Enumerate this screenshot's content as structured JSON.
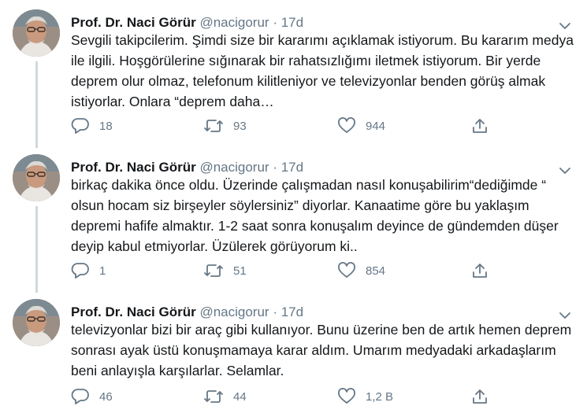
{
  "tweets": [
    {
      "name": "Prof. Dr. Naci Görür",
      "handle": "@nacigorur",
      "separator": "·",
      "time": "17d",
      "text": "Sevgili takipcilerim. Şimdi size bir kararımı açıklamak istiyorum. Bu kararım medya ile ilgili. Hoşgörülerine sığınarak bir rahatsızlığımı iletmek istiyorum. Bir yerde deprem olur olmaz, telefonum kilitleniyor ve televizyonlar benden görüş almak istiyorlar. Onlara “deprem daha…",
      "replies": "18",
      "retweets": "93",
      "likes": "944"
    },
    {
      "name": "Prof. Dr. Naci Görür",
      "handle": "@nacigorur",
      "separator": "·",
      "time": "17d",
      "text": "birkaç dakika önce oldu. Üzerinde çalışmadan nasıl konuşabilirim“dediğimde “ olsun hocam siz birşeyler söylersiniz” diyorlar. Kanaatime göre bu yaklaşım depremi hafife almaktır. 1-2 saat sonra konuşalım deyince de gündemden düşer deyip kabul etmiyorlar. Üzülerek görüyorum ki..",
      "replies": "1",
      "retweets": "51",
      "likes": "854"
    },
    {
      "name": "Prof. Dr. Naci Görür",
      "handle": "@nacigorur",
      "separator": "·",
      "time": "17d",
      "text": "televizyonlar bizi bir araç gibi kullanıyor. Bunu üzerine ben de artık hemen deprem sonrası ayak üstü konuşmamaya karar aldım. Umarım medyadaki arkadaşlarım beni anlayışla karşılarlar. Selamlar.",
      "replies": "46",
      "retweets": "44",
      "likes": "1,2 B"
    }
  ],
  "icons": {
    "reply": "reply-icon",
    "retweet": "retweet-icon",
    "like": "heart-icon",
    "share": "share-icon",
    "more": "chevron-down-icon"
  },
  "colors": {
    "text": "#14171a",
    "secondary": "#657786",
    "thread_line": "#cfd9de"
  }
}
